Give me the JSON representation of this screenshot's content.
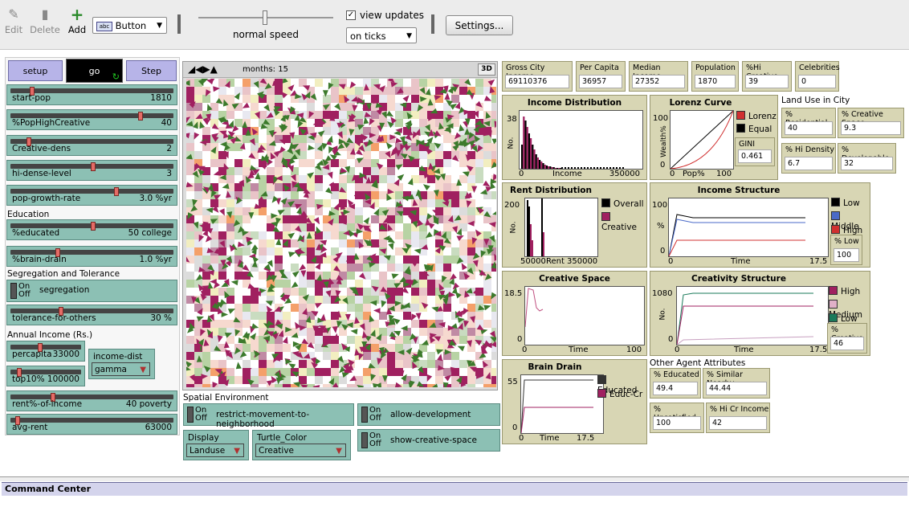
{
  "toolbar": {
    "edit": "Edit",
    "delete": "Delete",
    "add": "Add",
    "widget_type": "Button",
    "widget_abc": "abc",
    "speed_label": "normal speed",
    "view_updates": "view updates",
    "update_mode": "on ticks",
    "settings": "Settings..."
  },
  "buttons": {
    "setup": "setup",
    "go": "go",
    "step": "Step"
  },
  "sliders": [
    {
      "label": "start-pop",
      "value": "1810",
      "frac": 0.12
    },
    {
      "label": "%PopHighCreative",
      "value": "40",
      "frac": 0.8
    },
    {
      "label": "Creative-dens",
      "value": "2",
      "frac": 0.1
    },
    {
      "label": "hi-dense-level",
      "value": "3",
      "frac": 0.5
    },
    {
      "label": "pop-growth-rate",
      "value": "3.0 %yr",
      "frac": 0.65
    }
  ],
  "education": {
    "title": "Education",
    "educated": {
      "label": "%educated",
      "value": "50 college",
      "frac": 0.5
    },
    "brain_drain": {
      "label": "%brain-drain",
      "value": "1.0 %yr",
      "frac": 0.28
    }
  },
  "segregation": {
    "title": "Segregation and Tolerance",
    "switch_on": "On",
    "switch_off": "Off",
    "switch_label": "segregation",
    "tolerance": {
      "label": "tolerance-for-others",
      "value": "30 %",
      "frac": 0.3
    }
  },
  "income": {
    "title": "Annual Income (Rs.)",
    "percapita": {
      "label": "percapita",
      "value": "33000",
      "frac": 0.4
    },
    "top10": {
      "label": "top10%",
      "value": "100000",
      "frac": 0.1
    },
    "income_dist": {
      "label": "income-dist",
      "value": "gamma"
    },
    "rent_pct": {
      "label": "rent%-of-income",
      "value": "40 poverty",
      "frac": 0.25
    },
    "avg_rent": {
      "label": "avg-rent",
      "value": "63000",
      "frac": 0.03
    }
  },
  "view": {
    "months_label": "months: 15",
    "btn_3d": "3D"
  },
  "spatial": {
    "title": "Spatial Environment",
    "restrict": "restrict-movement-to-neighborhood",
    "allow_dev": "allow-development",
    "show_creative": "show-creative-space",
    "on": "On",
    "off": "Off",
    "display": {
      "label": "Display",
      "value": "Landuse"
    },
    "turtle_color": {
      "label": "Turtle_Color",
      "value": "Creative"
    }
  },
  "monitors_top": [
    {
      "label": "Gross City Income",
      "value": "69110376"
    },
    {
      "label": "Per Capita",
      "value": "36957"
    },
    {
      "label": "Median Income",
      "value": "27352"
    },
    {
      "label": "Population",
      "value": "1870"
    },
    {
      "label": "%Hi Creative",
      "value": "39"
    },
    {
      "label": "Celebrities",
      "value": "0"
    }
  ],
  "land_use": {
    "title": "Land Use in City",
    "monitors": [
      {
        "label": "% Residential",
        "value": "40"
      },
      {
        "label": "% Creative Space",
        "value": "9.3"
      },
      {
        "label": "% Hi Density",
        "value": "6.7"
      },
      {
        "label": "% Developable",
        "value": "32"
      }
    ]
  },
  "other": {
    "title": "Other Agent Attributes",
    "monitors": [
      {
        "label": "% Educated",
        "value": "49.4"
      },
      {
        "label": "% Similar Nearby",
        "value": "44.44"
      },
      {
        "label": "% Unsatisfied",
        "value": "100"
      },
      {
        "label": "% Hi Cr Income",
        "value": "42"
      }
    ]
  },
  "plots": {
    "income_dist": {
      "title": "Income Distribution",
      "ymax": "38",
      "ylabel": "No.",
      "xmin": "0",
      "xlabel": "Income",
      "xmax": "350000"
    },
    "lorenz": {
      "title": "Lorenz Curve",
      "ymax": "100",
      "ymin": "0",
      "ylabel": "Wealth%",
      "xmin": "0",
      "xlabel": "Pop%",
      "xmax": "100",
      "legend": [
        "Lorenz",
        "Equal"
      ],
      "gini_label": "GINI",
      "gini": "0.461"
    },
    "rent_dist": {
      "title": "Rent Distribution",
      "ymax": "200",
      "ylabel": "No.",
      "xmin": "50000",
      "xlabel": "Rent",
      "xmax": "350000",
      "legend": [
        "Overall",
        "Creative"
      ]
    },
    "income_struct": {
      "title": "Income Structure",
      "ymax": "100",
      "ymin": "0",
      "ylabel": "%",
      "xmin": "0",
      "xlabel": "Time",
      "xmax": "17.5",
      "legend": [
        "Low",
        "Middle",
        "High"
      ],
      "mon_label": "% Low",
      "mon_value": "100"
    },
    "creative_space": {
      "title": "Creative Space",
      "ymax": "18.5",
      "ymin": "0",
      "xmin": "0",
      "xlabel": "Time",
      "xmax": "100"
    },
    "creativity_struct": {
      "title": "Creativity Structure",
      "ymax": "1080",
      "ymin": "0",
      "ylabel": "No.",
      "xmin": "0",
      "xlabel": "Time",
      "xmax": "17.5",
      "legend": [
        "High",
        "Medium",
        "Low"
      ],
      "mon_label": "% Creative",
      "mon_value": "46"
    },
    "brain_drain": {
      "title": "Brain Drain",
      "ymax": "55",
      "ymin": "0",
      "xmin": "0",
      "xlabel": "Time",
      "xmax": "17.5",
      "legend": [
        "Educated",
        "Educ-Cr"
      ]
    }
  },
  "command_center": {
    "title": "Command Center"
  },
  "colors": {
    "teal": "#8cc0b4",
    "lavender": "#b7b4e8",
    "plot_bg": "#d8d6b4",
    "magenta": "#a02060",
    "green": "#2a7a3a"
  }
}
